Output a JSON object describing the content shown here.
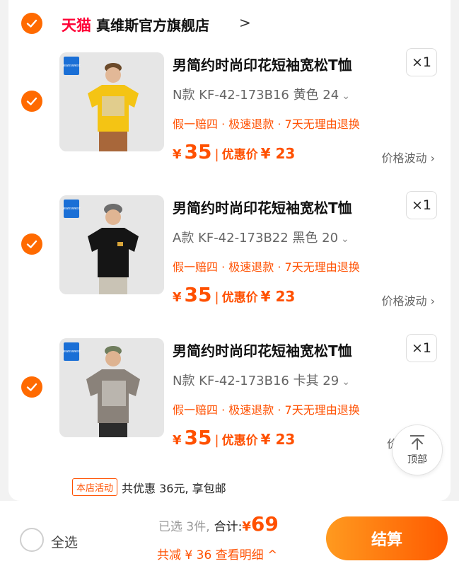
{
  "store": {
    "platform": "天猫",
    "name": "真维斯官方旗舰店",
    "chevron": ">"
  },
  "items": [
    {
      "title": "男简约时尚印花短袖宽松T恤",
      "qty": "×1",
      "sku": "N款 KF-42-173B16 黄色 24",
      "promo": "假一赔四 · 极速退款 · 7天无理由退换",
      "price_symbol": "¥",
      "price": "35",
      "discount_label": "优惠价",
      "discount_price": "¥ 23",
      "fluctuation": "价格波动",
      "shirt_color": "#f4c414",
      "badge": "Jeanswest"
    },
    {
      "title": "男简约时尚印花短袖宽松T恤",
      "qty": "×1",
      "sku": "A款 KF-42-173B22 黑色 20",
      "promo": "假一赔四 · 极速退款 · 7天无理由退换",
      "price_symbol": "¥",
      "price": "35",
      "discount_label": "优惠价",
      "discount_price": "¥ 23",
      "fluctuation": "价格波动",
      "shirt_color": "#151515",
      "badge": "Jeanswest"
    },
    {
      "title": "男简约时尚印花短袖宽松T恤",
      "qty": "×1",
      "sku": "N款 KF-42-173B16 卡其 29",
      "promo": "假一赔四 · 极速退款 · 7天无理由退换",
      "price_symbol": "¥",
      "price": "35",
      "discount_label": "优惠价",
      "discount_price": "¥ 23",
      "fluctuation": "价格",
      "shirt_color": "#8a827a",
      "badge": "Jeanswest"
    }
  ],
  "scroll_top": {
    "label": "顶部"
  },
  "activity": {
    "tag": "本店活动",
    "text": "共优惠 36元, 享包邮"
  },
  "footer": {
    "select_all": "全选",
    "selected_count": "已选 3件,",
    "total_label": "合计:",
    "currency": "¥",
    "total": "69",
    "savings_detail": "共减 ¥ 36  查看明细 ^",
    "checkout": "结算"
  },
  "colors": {
    "accent": "#ff5000",
    "check": "#ff6a00",
    "tmall": "#ff0036"
  }
}
